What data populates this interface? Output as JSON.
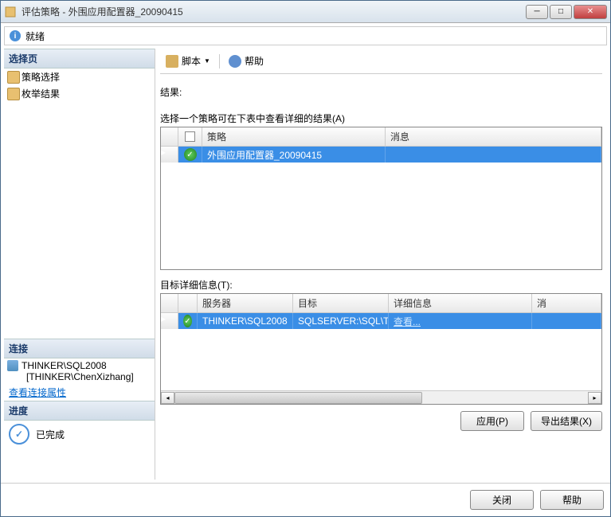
{
  "titlebar": {
    "title": "评估策略 - 外围应用配置器_20090415"
  },
  "status": {
    "text": "就绪"
  },
  "sidebar": {
    "select_page_header": "选择页",
    "items": [
      "策略选择",
      "枚举结果"
    ],
    "connection_header": "连接",
    "server": "THINKER\\SQL2008",
    "user": "[THINKER\\ChenXizhang]",
    "view_conn_link": "查看连接属性",
    "progress_header": "进度",
    "progress_status": "已完成"
  },
  "toolbar": {
    "script": "脚本",
    "help": "帮助"
  },
  "results": {
    "label": "结果:",
    "instruction": "选择一个策略可在下表中查看详细的结果(A)",
    "columns": {
      "policy": "策略",
      "message": "消息"
    },
    "row": {
      "policy": "外围应用配置器_20090415",
      "message": ""
    }
  },
  "details": {
    "label": "目标详细信息(T):",
    "columns": {
      "server": "服务器",
      "target": "目标",
      "info": "详细信息",
      "msg": "消"
    },
    "row": {
      "server": "THINKER\\SQL2008",
      "target": "SQLSERVER:\\SQL\\T...",
      "info": "查看..."
    }
  },
  "buttons": {
    "apply": "应用(P)",
    "export": "导出结果(X)",
    "close": "关闭",
    "help": "帮助"
  }
}
